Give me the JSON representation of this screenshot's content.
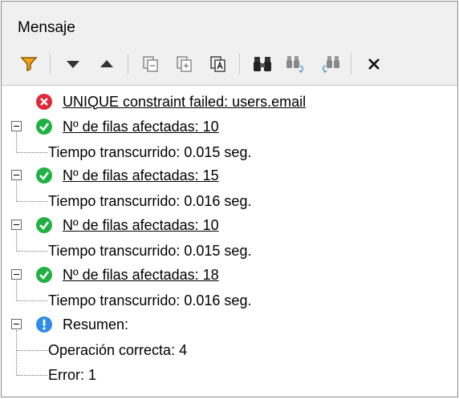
{
  "panel": {
    "title": "Mensaje"
  },
  "toolbar": {
    "buttons": [
      {
        "name": "filter-icon"
      },
      {
        "name": "next-down-icon"
      },
      {
        "name": "prev-up-icon"
      },
      {
        "name": "copy-selected-icon"
      },
      {
        "name": "copy-all-icon"
      },
      {
        "name": "copy-text-icon"
      },
      {
        "name": "find-icon"
      },
      {
        "name": "find-next-icon"
      },
      {
        "name": "find-prev-icon"
      },
      {
        "name": "close-icon"
      }
    ]
  },
  "messages": {
    "error": "UNIQUE constraint failed: users.email",
    "results": [
      {
        "affected": "Nº de filas afectadas: 10",
        "time": "Tiempo transcurrido: 0.015 seg."
      },
      {
        "affected": "Nº de filas afectadas: 15",
        "time": "Tiempo transcurrido: 0.016 seg."
      },
      {
        "affected": "Nº de filas afectadas: 10",
        "time": "Tiempo transcurrido: 0.015 seg."
      },
      {
        "affected": "Nº de filas afectadas: 18",
        "time": "Tiempo transcurrido: 0.016 seg."
      }
    ],
    "summary": {
      "label": "Resumen:",
      "ok": "Operación correcta: 4",
      "error": "Error: 1"
    }
  },
  "colors": {
    "error": "#e0283a",
    "success": "#1fb141",
    "info": "#2f8be6",
    "filter": "#f2a31c"
  }
}
